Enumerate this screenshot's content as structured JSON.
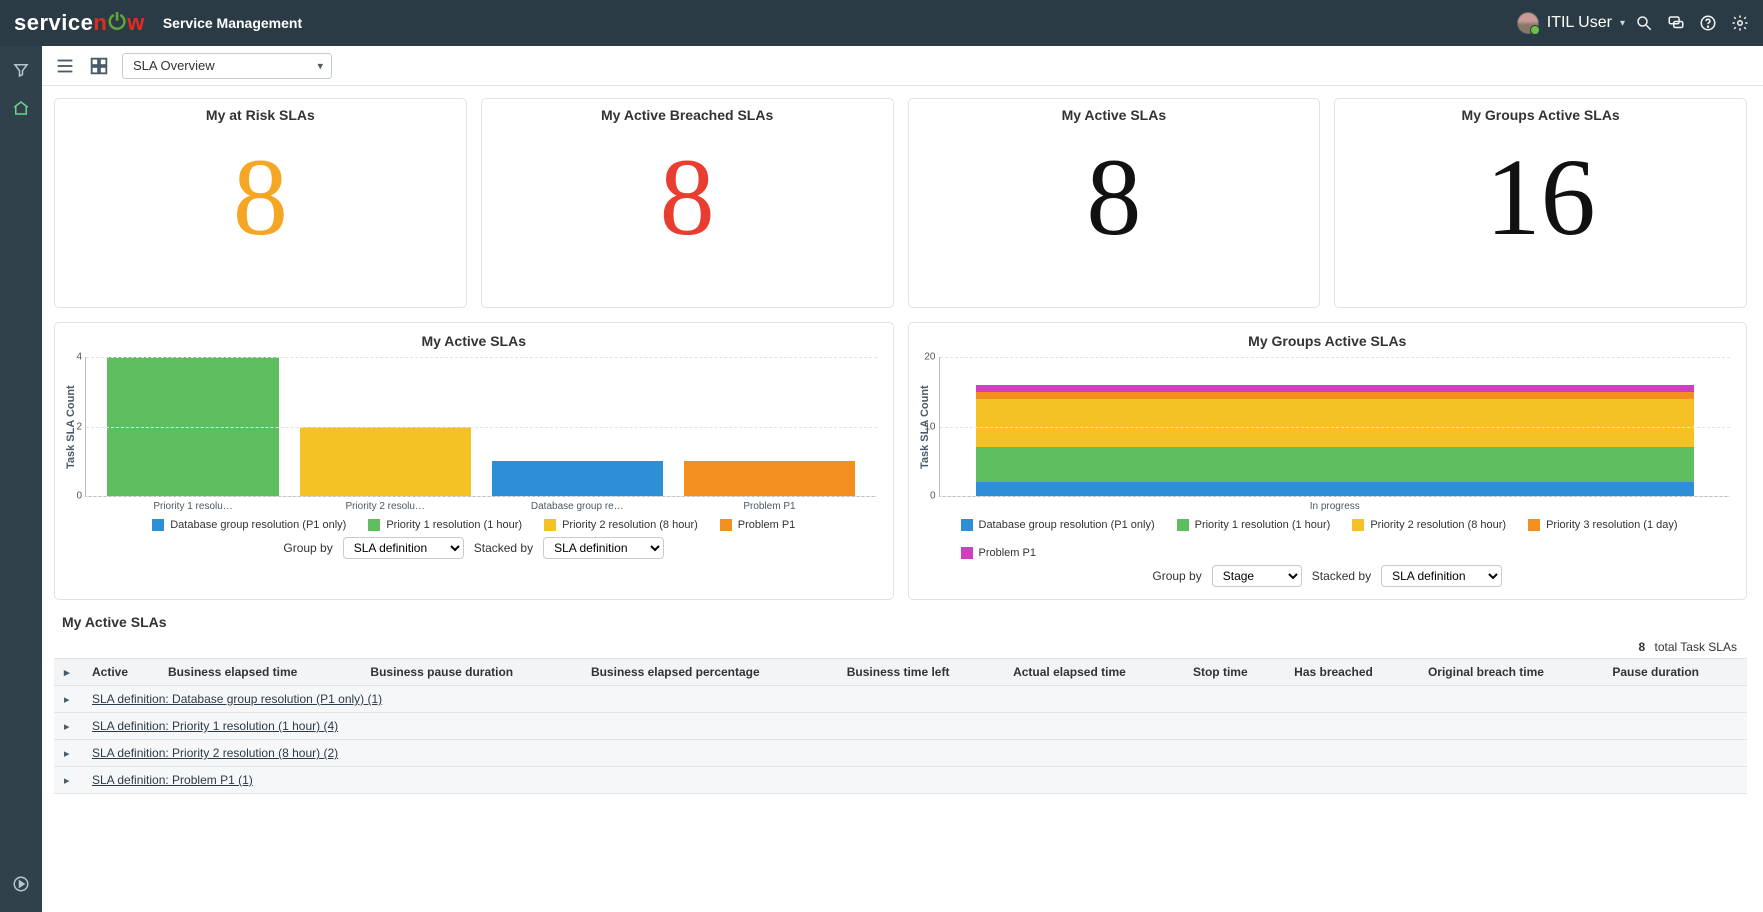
{
  "header": {
    "app_title": "Service Management",
    "user_name": "ITIL User"
  },
  "toolbar": {
    "selector_value": "SLA Overview"
  },
  "cards": [
    {
      "title": "My at Risk SLAs",
      "value": "8",
      "color": "#f5a623"
    },
    {
      "title": "My Active Breached SLAs",
      "value": "8",
      "color": "#e93e2f"
    },
    {
      "title": "My Active SLAs",
      "value": "8",
      "color": "#111"
    },
    {
      "title": "My Groups Active SLAs",
      "value": "16",
      "color": "#111"
    }
  ],
  "chart_left": {
    "title": "My Active SLAs",
    "group_by_label": "Group by",
    "group_by_value": "SLA definition",
    "stacked_by_label": "Stacked by",
    "stacked_by_value": "SLA definition"
  },
  "chart_right": {
    "title": "My Groups Active SLAs",
    "group_by_label": "Group by",
    "group_by_value": "Stage",
    "stacked_by_label": "Stacked by",
    "stacked_by_value": "SLA definition"
  },
  "table": {
    "title": "My Active SLAs",
    "total_count": "8",
    "total_label": "total Task SLAs",
    "columns": [
      "Active",
      "Business elapsed time",
      "Business pause duration",
      "Business elapsed percentage",
      "Business time left",
      "Actual elapsed time",
      "Stop time",
      "Has breached",
      "Original breach time",
      "Pause duration"
    ],
    "groups": [
      "SLA definition: Database group resolution (P1 only) (1)",
      "SLA definition: Priority 1 resolution (1 hour) (4)",
      "SLA definition: Priority 2 resolution (8 hour) (2)",
      "SLA definition: Problem P1 (1)"
    ]
  },
  "chart_data": [
    {
      "type": "bar",
      "title": "My Active SLAs",
      "ylabel": "Task SLA Count",
      "ylim": [
        0,
        4
      ],
      "categories": [
        "Priority 1 resolu…",
        "Priority 2 resolu…",
        "Database group re…",
        "Problem P1"
      ],
      "values": [
        4,
        2,
        1,
        1
      ],
      "bar_colors": [
        "#5ebd5e",
        "#f4c224",
        "#2f8fd6",
        "#f28f1e"
      ],
      "legend": [
        {
          "label": "Database group resolution (P1 only)",
          "color": "#2f8fd6"
        },
        {
          "label": "Priority 1 resolution (1 hour)",
          "color": "#5ebd5e"
        },
        {
          "label": "Priority 2 resolution (8 hour)",
          "color": "#f4c224"
        },
        {
          "label": "Problem P1",
          "color": "#f28f1e"
        }
      ],
      "controls": {
        "group_by": "SLA definition",
        "stacked_by": "SLA definition"
      }
    },
    {
      "type": "bar",
      "stacked": true,
      "title": "My Groups Active SLAs",
      "ylabel": "Task SLA Count",
      "ylim": [
        0,
        20
      ],
      "categories": [
        "In progress"
      ],
      "series": [
        {
          "name": "Database group resolution (P1 only)",
          "color": "#2f8fd6",
          "values": [
            2
          ]
        },
        {
          "name": "Priority 1 resolution (1 hour)",
          "color": "#5ebd5e",
          "values": [
            5
          ]
        },
        {
          "name": "Priority 2 resolution (8 hour)",
          "color": "#f4c224",
          "values": [
            7
          ]
        },
        {
          "name": "Priority 3 resolution (1 day)",
          "color": "#f28f1e",
          "values": [
            1
          ]
        },
        {
          "name": "Problem P1",
          "color": "#cf3fbf",
          "values": [
            1
          ]
        }
      ],
      "controls": {
        "group_by": "Stage",
        "stacked_by": "SLA definition"
      }
    }
  ]
}
